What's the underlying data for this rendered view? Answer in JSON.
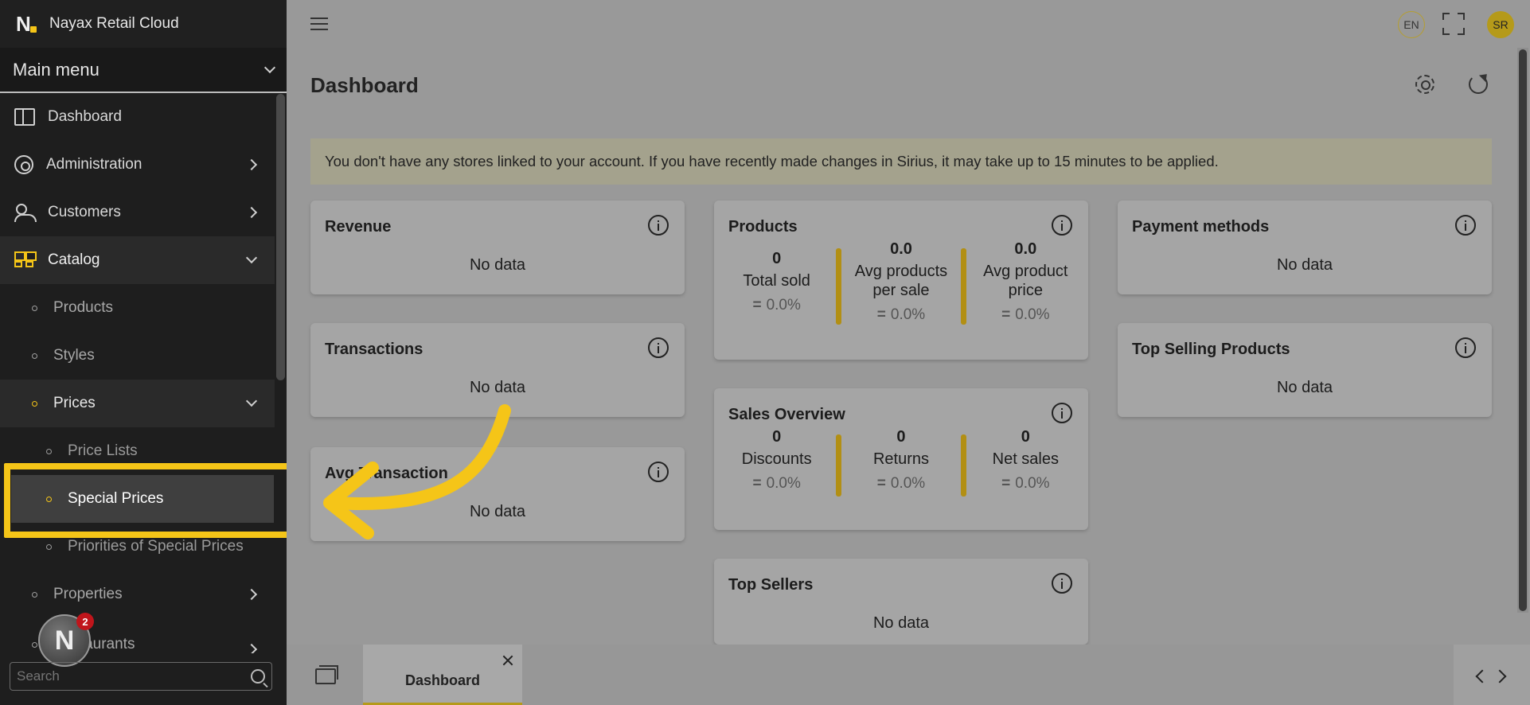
{
  "app": {
    "name": "Nayax Retail Cloud",
    "logo_letter": "N"
  },
  "sidebar": {
    "main_menu_label": "Main menu",
    "items": [
      {
        "label": "Dashboard"
      },
      {
        "label": "Administration"
      },
      {
        "label": "Customers"
      },
      {
        "label": "Catalog"
      }
    ],
    "catalog_children": [
      {
        "label": "Products"
      },
      {
        "label": "Styles"
      },
      {
        "label": "Prices"
      }
    ],
    "prices_children": [
      {
        "label": "Price Lists"
      },
      {
        "label": "Special Prices"
      },
      {
        "label": "Priorities of Special Prices"
      }
    ],
    "more": [
      {
        "label": "Properties"
      },
      {
        "label": "Restaurants"
      }
    ],
    "search_placeholder": "Search",
    "notification_count": "2"
  },
  "topbar": {
    "language": "EN",
    "avatar_initials": "SR"
  },
  "main": {
    "title": "Dashboard",
    "alert": "You don't have any stores linked to your account. If you have recently made changes in Sirius, it may take up to 15 minutes to be applied.",
    "no_data": "No data",
    "cards": {
      "revenue": "Revenue",
      "transactions": "Transactions",
      "avg_transaction": "Avg Transaction",
      "products": "Products",
      "sales_overview": "Sales Overview",
      "top_sellers": "Top Sellers",
      "payment_methods": "Payment methods",
      "top_selling_products": "Top Selling Products"
    },
    "products_stats": [
      {
        "value": "0",
        "label": "Total sold",
        "pct": "0.0%"
      },
      {
        "value": "0.0",
        "label": "Avg products per sale",
        "pct": "0.0%"
      },
      {
        "value": "0.0",
        "label": "Avg product price",
        "pct": "0.0%"
      }
    ],
    "sales_stats": [
      {
        "value": "0",
        "label": "Discounts",
        "pct": "0.0%"
      },
      {
        "value": "0",
        "label": "Returns",
        "pct": "0.0%"
      },
      {
        "value": "0",
        "label": "Net sales",
        "pct": "0.0%"
      }
    ],
    "eq_symbol": "="
  },
  "bottombar": {
    "tab_label": "Dashboard"
  },
  "colors": {
    "accent": "#f5c518",
    "sidebar_bg": "#1e1e1e",
    "overlay_bg": "#999999"
  }
}
